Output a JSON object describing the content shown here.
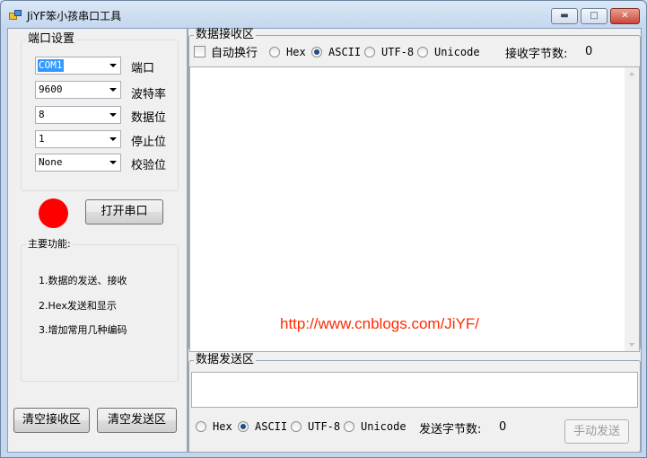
{
  "window": {
    "title": "JiYF笨小孩串口工具",
    "minimize_label": "▬",
    "maximize_label": "□",
    "close_label": "✕"
  },
  "port_settings": {
    "legend": "端口设置",
    "fields": [
      {
        "value": "COM1",
        "label": "端口"
      },
      {
        "value": "9600",
        "label": "波特率"
      },
      {
        "value": "8",
        "label": "数据位"
      },
      {
        "value": "1",
        "label": "停止位"
      },
      {
        "value": "None",
        "label": "校验位"
      }
    ]
  },
  "status": {
    "indicator_color": "#ff0000"
  },
  "open_port_button": "打开串口",
  "features": {
    "legend": "主要功能:",
    "items": [
      "1.数据的发送、接收",
      "2.Hex发送和显示",
      "3.增加常用几种编码"
    ]
  },
  "clear_receive_button": "清空接收区",
  "clear_send_button": "清空发送区",
  "receive": {
    "legend": "数据接收区",
    "auto_wrap_label": "自动换行",
    "auto_wrap_checked": false,
    "encodings": [
      "Hex",
      "ASCII",
      "UTF-8",
      "Unicode"
    ],
    "selected_encoding": "ASCII",
    "byte_count_label": "接收字节数:",
    "byte_count": "0",
    "watermark": "http://www.cnblogs.com/JiYF/"
  },
  "send": {
    "legend": "数据发送区",
    "encodings": [
      "Hex",
      "ASCII",
      "UTF-8",
      "Unicode"
    ],
    "selected_encoding": "ASCII",
    "byte_count_label": "发送字节数:",
    "byte_count": "0",
    "send_button": "手动发送"
  }
}
